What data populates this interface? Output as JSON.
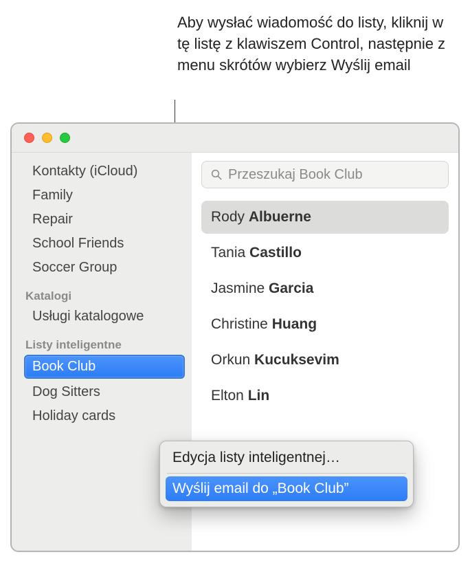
{
  "callout": "Aby wysłać wiadomość do listy, kliknij w tę listę z klawiszem Control, następnie z menu skrótów wybierz Wyślij email",
  "sidebar": {
    "groups": [
      {
        "header": null,
        "items": [
          {
            "label": "Kontakty (iCloud)",
            "selected": false
          },
          {
            "label": "Family",
            "selected": false
          },
          {
            "label": "Repair",
            "selected": false
          },
          {
            "label": "School Friends",
            "selected": false
          },
          {
            "label": "Soccer Group",
            "selected": false
          }
        ]
      },
      {
        "header": "Katalogi",
        "items": [
          {
            "label": "Usługi katalogowe",
            "selected": false
          }
        ]
      },
      {
        "header": "Listy inteligentne",
        "items": [
          {
            "label": "Book Club",
            "selected": true
          },
          {
            "label": "Dog Sitters",
            "selected": false
          },
          {
            "label": "Holiday cards",
            "selected": false
          }
        ]
      }
    ]
  },
  "search": {
    "placeholder": "Przeszukaj Book Club"
  },
  "contacts": [
    {
      "first": "Rody",
      "last": "Albuerne",
      "selected": true
    },
    {
      "first": "Tania",
      "last": "Castillo",
      "selected": false
    },
    {
      "first": "Jasmine",
      "last": "Garcia",
      "selected": false
    },
    {
      "first": "Christine",
      "last": "Huang",
      "selected": false
    },
    {
      "first": "Orkun",
      "last": "Kucuksevim",
      "selected": false
    },
    {
      "first": "Elton",
      "last": "Lin",
      "selected": false
    }
  ],
  "context_menu": {
    "edit_label": "Edycja listy inteligentnej…",
    "send_label": "Wyślij email do „Book Club”"
  }
}
